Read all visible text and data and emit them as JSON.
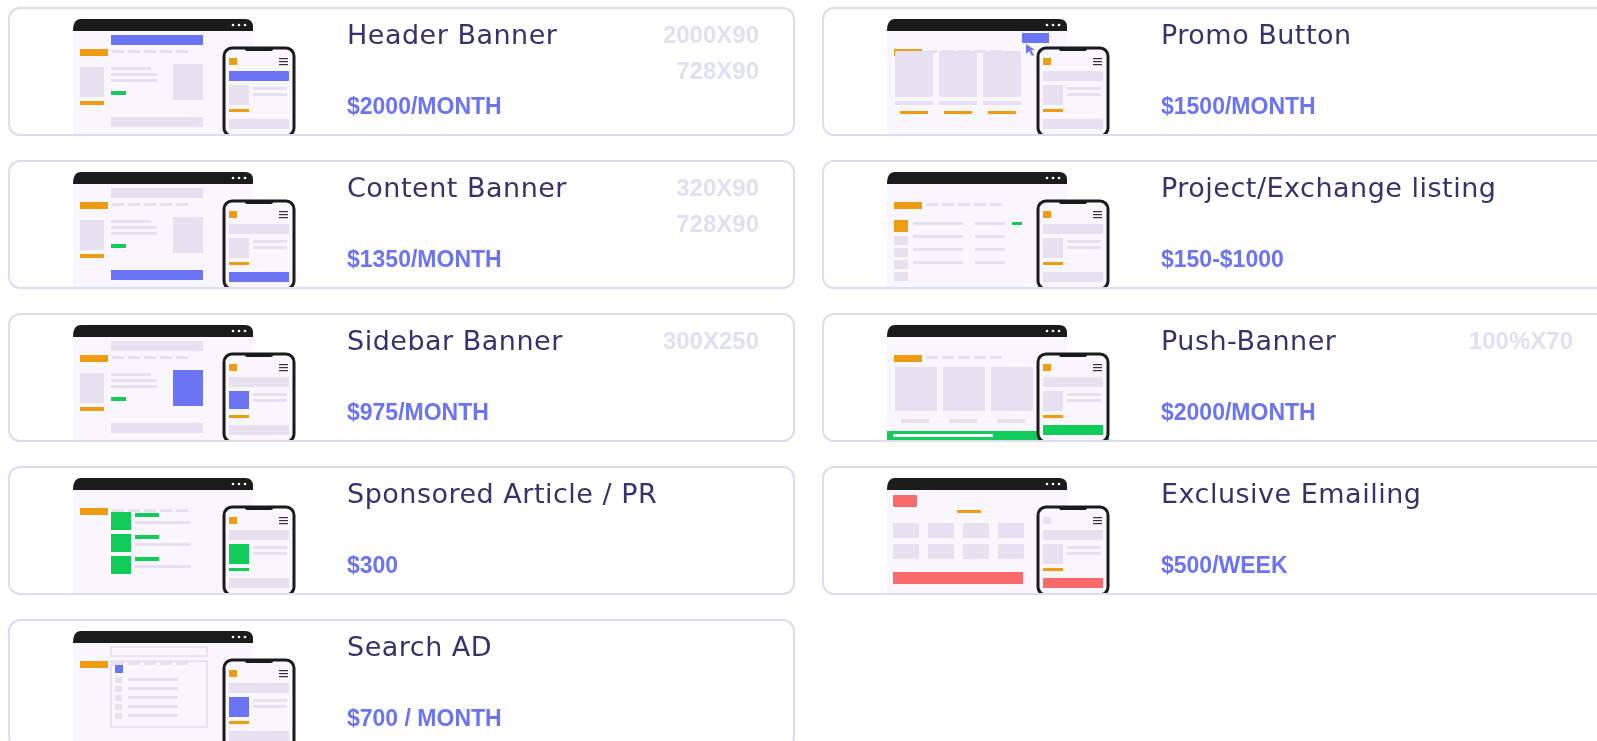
{
  "cards": [
    {
      "kind": "header",
      "title": "Header Banner",
      "price": "$2000/MONTH",
      "sizes": [
        "2000X90",
        "728X90"
      ]
    },
    {
      "kind": "promo",
      "title": "Promo Button",
      "price": "$1500/MONTH"
    },
    {
      "kind": "content",
      "title": "Content Banner",
      "price": "$1350/MONTH",
      "sizes": [
        "320X90",
        "728X90"
      ]
    },
    {
      "kind": "listing",
      "title": "Project/Exchange listing",
      "price": "$150-$1000"
    },
    {
      "kind": "sidebar",
      "title": "Sidebar Banner",
      "price": "$975/MONTH",
      "sizes": [
        "300X250"
      ]
    },
    {
      "kind": "push",
      "title": "Push-Banner",
      "price": "$2000/MONTH",
      "sizes": [
        "100%X70"
      ]
    },
    {
      "kind": "article",
      "title": "Sponsored Article / PR",
      "price": "$300"
    },
    {
      "kind": "email",
      "title": "Exclusive Emailing",
      "price": "$500/WEEK"
    },
    {
      "kind": "search",
      "title": "Search AD",
      "price": "$700 / MONTH"
    }
  ]
}
